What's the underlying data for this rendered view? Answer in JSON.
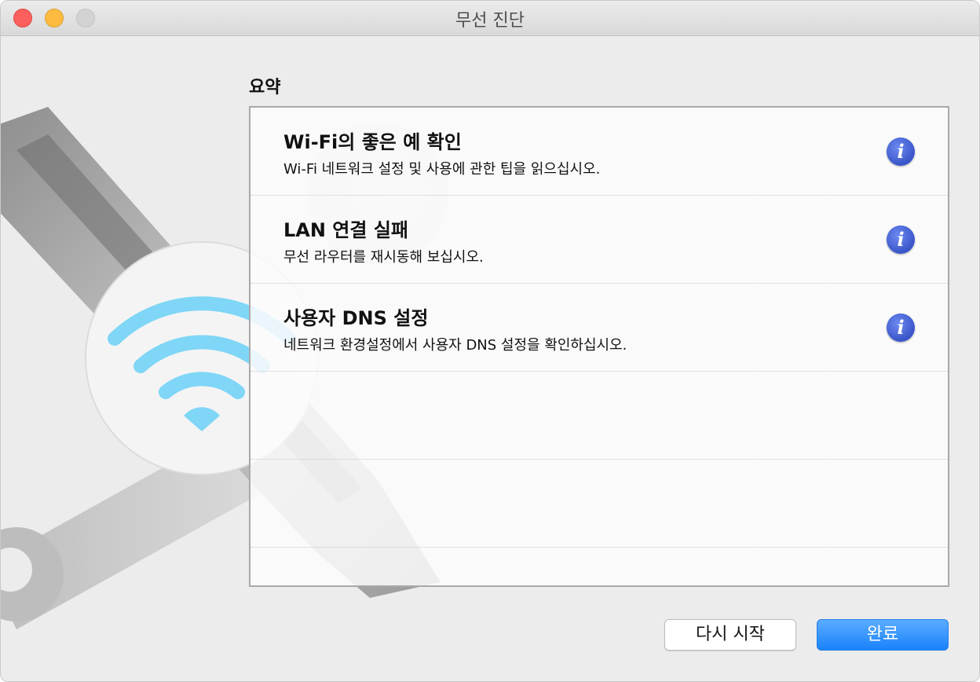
{
  "window": {
    "title": "무선 진단"
  },
  "summary": {
    "heading": "요약",
    "items": [
      {
        "title": "Wi-Fi의 좋은 예 확인",
        "description": "Wi-Fi 네트워크 설정 및 사용에 관한 팁을 읽으십시오.",
        "icon": "info-icon"
      },
      {
        "title": "LAN 연결 실패",
        "description": "무선 라우터를 재시동해 보십시오.",
        "icon": "info-icon"
      },
      {
        "title": "사용자 DNS 설정",
        "description": "네트워크 환경설정에서 사용자 DNS 설정을 확인하십시오.",
        "icon": "info-icon"
      }
    ]
  },
  "buttons": {
    "restart_label": "다시 시작",
    "done_label": "완료"
  },
  "colors": {
    "accent": "#1a82fb",
    "info_icon": "#3a55c9",
    "wifi": "#6ccff5"
  }
}
